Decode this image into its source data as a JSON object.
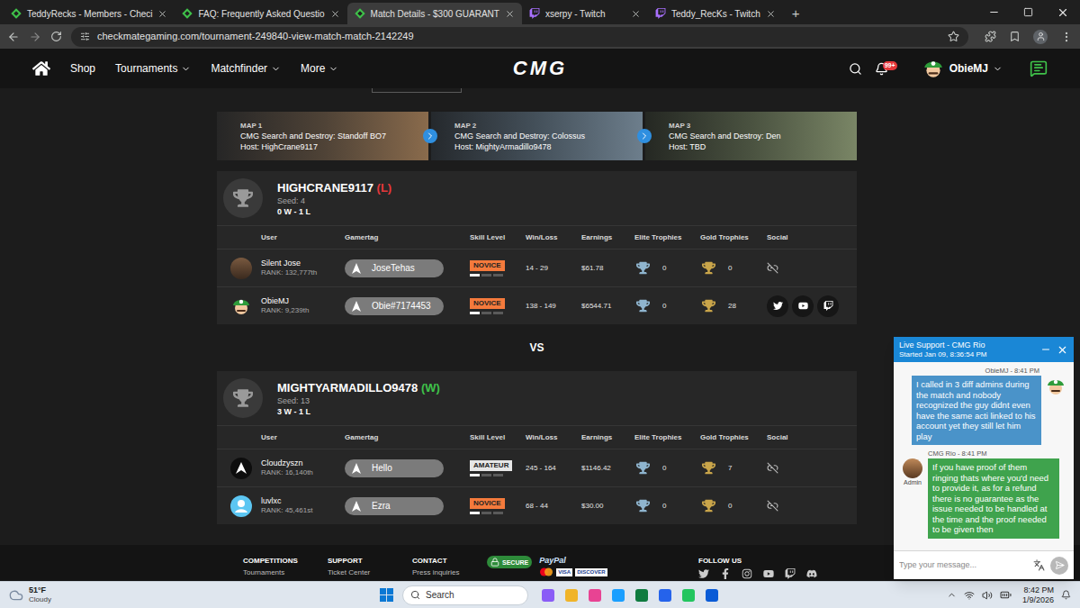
{
  "browser": {
    "tabs": [
      {
        "label": "TeddyRecks - Members - Checi",
        "kind": "cmg",
        "selected": false
      },
      {
        "label": "FAQ: Frequently Asked Questio",
        "kind": "cmg",
        "selected": false
      },
      {
        "label": "Match Details - $300 GUARANT",
        "kind": "cmg",
        "selected": true
      },
      {
        "label": "xserpy - Twitch",
        "kind": "twitch",
        "selected": false
      },
      {
        "label": "Teddy_RecKs - Twitch",
        "kind": "twitch",
        "selected": false
      }
    ],
    "new_tab": "+",
    "url": "checkmategaming.com/tournament-249840-view-match-match-2142249"
  },
  "site_header": {
    "nav": [
      {
        "label": "Shop",
        "dropdown": false
      },
      {
        "label": "Tournaments",
        "dropdown": true
      },
      {
        "label": "Matchfinder",
        "dropdown": true
      },
      {
        "label": "More",
        "dropdown": true
      }
    ],
    "logo": "CMG",
    "notifications": "99+",
    "username": "ObieMJ"
  },
  "maps": [
    {
      "label": "MAP 1",
      "mode": "CMG Search and Destroy: Standoff BO7",
      "host": "Host: HighCrane9117"
    },
    {
      "label": "MAP 2",
      "mode": "CMG Search and Destroy: Colossus",
      "host": "Host: MightyArmadillo9478"
    },
    {
      "label": "MAP 3",
      "mode": "CMG Search and Destroy: Den",
      "host": "Host: TBD"
    }
  ],
  "columns": [
    "User",
    "Gamertag",
    "Skill Level",
    "Win/Loss",
    "Earnings",
    "Elite Trophies",
    "Gold Trophies",
    "Social"
  ],
  "teams": [
    {
      "name": "HIGHCRANE9117",
      "result": "(L)",
      "color": "#e5383b",
      "seed": "Seed: 4",
      "record": "0 W - 1 L",
      "players": [
        {
          "user": "Silent Jose",
          "rank": "RANK: 132,777th",
          "avatar_kind": "photo",
          "gamertag": "JoseTehas",
          "skill": "NOVICE",
          "skill_color": "#f47a3c",
          "level": 0.33,
          "win_loss": "14 - 29",
          "earnings": "$61.78",
          "elite_trophies": "0",
          "gold_trophies": "0",
          "social_linked": false
        },
        {
          "user": "ObieMJ",
          "rank": "RANK: 9,239th",
          "avatar_kind": "mario",
          "gamertag": "Obie#7174453",
          "skill": "NOVICE",
          "skill_color": "#f47a3c",
          "level": 0.33,
          "win_loss": "138 - 149",
          "earnings": "$6544.71",
          "elite_trophies": "0",
          "gold_trophies": "28",
          "social_linked": true
        }
      ]
    },
    {
      "name": "MIGHTYARMADILLO9478",
      "result": "(W)",
      "color": "#3fc24a",
      "seed": "Seed: 13",
      "record": "3 W - 1 L",
      "players": [
        {
          "user": "Cloudzyszn",
          "rank": "RANK: 16,140th",
          "avatar_kind": "logo",
          "gamertag": "Hello",
          "skill": "AMATEUR",
          "skill_color": "#e6e6e6",
          "level": 0.33,
          "win_loss": "245 - 164",
          "earnings": "$1146.42",
          "elite_trophies": "0",
          "gold_trophies": "7",
          "social_linked": false
        },
        {
          "user": "luvlxc",
          "rank": "RANK: 45,461st",
          "avatar_kind": "default",
          "gamertag": "Ezra",
          "skill": "NOVICE",
          "skill_color": "#f47a3c",
          "level": 0.33,
          "win_loss": "68 - 44",
          "earnings": "$30.00",
          "elite_trophies": "0",
          "gold_trophies": "0",
          "social_linked": false
        }
      ]
    }
  ],
  "vs": "VS",
  "footer": {
    "columns": [
      {
        "heading": "COMPETITIONS",
        "link": "Tournaments"
      },
      {
        "heading": "SUPPORT",
        "link": "Ticket Center"
      },
      {
        "heading": "CONTACT",
        "link": "Press inquiries"
      }
    ],
    "secure_badge": "SECURE",
    "payment_brand": "PayPal",
    "cards": [
      "VISA",
      "DISCOVER"
    ],
    "follow_heading": "FOLLOW US"
  },
  "chat": {
    "title": "Live Support - CMG Rio",
    "started": "Started Jan 09, 8:36:54 PM",
    "messages": [
      {
        "author": "ObieMJ - 8:41 PM",
        "mine": true,
        "role": "",
        "text": "I called in 3 diff admins during the match and nobody recognized the guy didnt even have the same acti linked to his account yet they still let him play"
      },
      {
        "author": "CMG Rio - 8:41 PM",
        "mine": false,
        "role": "Admin",
        "text": "If you have proof of them ringing thats where you'd need to provide it, as for a refund there is no guarantee as the issue needed to be handled at the time and the proof needed to be given then"
      }
    ],
    "placeholder": "Type your message..."
  },
  "taskbar": {
    "temperature": "51°F",
    "weather": "Cloudy",
    "search": "Search",
    "time": "8:42 PM",
    "date": "1/9/2026"
  }
}
